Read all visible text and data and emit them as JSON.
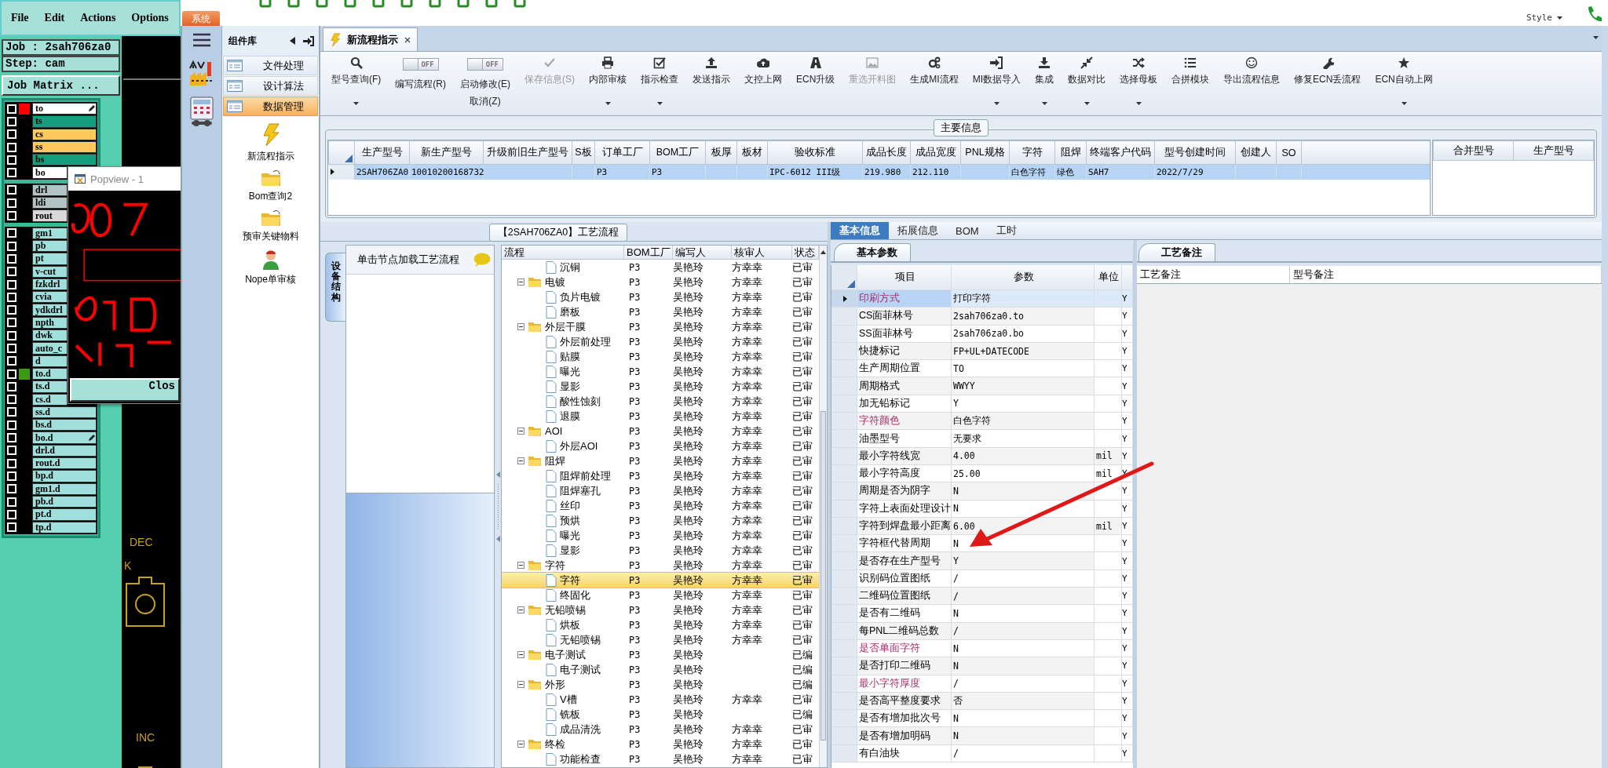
{
  "cam": {
    "menu": [
      "File",
      "Edit",
      "Actions",
      "Options"
    ],
    "job": "Job : 2sah706za0",
    "step": "Step: cam",
    "matrix_button": "Job Matrix ...",
    "layer_groups": [
      [
        {
          "name": "to",
          "kind": "legend",
          "color": "#ff0000",
          "checked": false,
          "flagged": true
        },
        {
          "name": "ts",
          "kind": "mask",
          "checked": false,
          "flagged": false
        },
        {
          "name": "cs",
          "kind": "copper",
          "checked": false,
          "flagged": false
        },
        {
          "name": "ss",
          "kind": "copper",
          "checked": false,
          "flagged": false
        },
        {
          "name": "bs",
          "kind": "mask",
          "checked": false,
          "flagged": false
        },
        {
          "name": "bo",
          "kind": "legend",
          "checked": false
        }
      ],
      [
        {
          "name": "drl",
          "kind": "drill",
          "checked": false
        },
        {
          "name": "ldi",
          "kind": "drill",
          "checked": false
        },
        {
          "name": "rout",
          "kind": "route",
          "checked": false
        }
      ],
      [
        {
          "name": "gm1",
          "kind": "misc",
          "checked": false
        },
        {
          "name": "pb",
          "kind": "misc",
          "checked": false
        },
        {
          "name": "pt",
          "kind": "misc",
          "checked": false
        },
        {
          "name": "v-cut",
          "kind": "misc",
          "checked": false
        },
        {
          "name": "fzkdrl",
          "kind": "misc",
          "checked": false
        },
        {
          "name": "cvia",
          "kind": "misc",
          "checked": false
        },
        {
          "name": "ydkdrl",
          "kind": "misc",
          "checked": false
        },
        {
          "name": "npth",
          "kind": "misc",
          "checked": false
        },
        {
          "name": "dwk",
          "kind": "misc",
          "checked": false
        },
        {
          "name": "auto_c",
          "kind": "misc",
          "checked": false
        },
        {
          "name": "d",
          "kind": "misc",
          "checked": false
        },
        {
          "name": "to.d",
          "kind": "misc",
          "color": "#3c9a10",
          "checked": false
        },
        {
          "name": "ts.d",
          "kind": "misc",
          "checked": false
        },
        {
          "name": "cs.d",
          "kind": "misc",
          "checked": false
        },
        {
          "name": "ss.d",
          "kind": "misc",
          "checked": false,
          "flagged": false
        },
        {
          "name": "bs.d",
          "kind": "misc",
          "checked": false,
          "flagged": false
        },
        {
          "name": "bo.d",
          "kind": "misc",
          "checked": false,
          "flagged": true
        },
        {
          "name": "drl.d",
          "kind": "misc",
          "checked": false,
          "flagged": false
        },
        {
          "name": "rout.d",
          "kind": "misc",
          "checked": false,
          "flagged": false
        },
        {
          "name": "bp.d",
          "kind": "misc",
          "checked": false,
          "flagged": false
        },
        {
          "name": "gm1.d",
          "kind": "misc",
          "checked": false,
          "flagged": false
        },
        {
          "name": "pb.d",
          "kind": "misc",
          "checked": false,
          "flagged": false
        },
        {
          "name": "pt.d",
          "kind": "misc",
          "checked": false,
          "flagged": false
        },
        {
          "name": "tp.d",
          "kind": "misc",
          "checked": false,
          "flagged": false
        }
      ]
    ],
    "popup": {
      "title": "Popview - 1",
      "button": "Clos"
    },
    "canvas_labels": [
      "DEC",
      "K",
      "INC"
    ]
  },
  "system_tab": "系统",
  "style_menu": "Style",
  "component_panel": {
    "title": "组件库",
    "categories": [
      {
        "label": "文件处理",
        "selected": false
      },
      {
        "label": "设计算法",
        "selected": false
      },
      {
        "label": "数据管理",
        "selected": true
      }
    ],
    "tools": [
      {
        "label": "新流程指示",
        "kind": "lightning"
      },
      {
        "label": "Bom查询2",
        "kind": "folder"
      },
      {
        "label": "预审关键物料",
        "kind": "folder"
      },
      {
        "label": "Nope单审核",
        "kind": "person"
      }
    ]
  },
  "document_tab": "新流程指示",
  "ribbon": [
    {
      "kind": "button",
      "label": "型号查询(F)",
      "dropdown": true,
      "disabled": false
    },
    {
      "kind": "toggle",
      "label": "编写流程(R)",
      "switch_text": "OFF",
      "on": false
    },
    {
      "kind": "toggle",
      "label": "启动修改(E)",
      "sublabel": "取消(Z)",
      "switch_text": "OFF",
      "on": false
    },
    {
      "kind": "button",
      "label": "保存信息(S)",
      "dropdown": false,
      "disabled": true
    },
    {
      "kind": "button",
      "label": "内部审核",
      "dropdown": true,
      "disabled": false
    },
    {
      "kind": "button",
      "label": "指示检查",
      "dropdown": true,
      "disabled": false
    },
    {
      "kind": "button",
      "label": "发送指示",
      "dropdown": false,
      "disabled": false
    },
    {
      "kind": "button",
      "label": "文控上网",
      "dropdown": false,
      "disabled": false
    },
    {
      "kind": "button",
      "label": "ECN升级",
      "dropdown": false,
      "disabled": false
    },
    {
      "kind": "button",
      "label": "重选开料图",
      "dropdown": false,
      "disabled": true
    },
    {
      "kind": "button",
      "label": "生成MI流程",
      "dropdown": false,
      "disabled": false
    },
    {
      "kind": "button",
      "label": "MI数据导入",
      "dropdown": true,
      "disabled": false
    },
    {
      "kind": "button",
      "label": "集成",
      "dropdown": true,
      "disabled": false
    },
    {
      "kind": "button",
      "label": "数据对比",
      "dropdown": true,
      "disabled": false
    },
    {
      "kind": "button",
      "label": "选择母板",
      "dropdown": true,
      "disabled": false
    },
    {
      "kind": "button",
      "label": "合拼模块",
      "dropdown": false,
      "disabled": false
    },
    {
      "kind": "button",
      "label": "导出流程信息",
      "dropdown": false,
      "disabled": false
    },
    {
      "kind": "button",
      "label": "修复ECN丢流程",
      "dropdown": false,
      "disabled": false
    },
    {
      "kind": "button",
      "label": "ECN自动上网",
      "dropdown": true,
      "disabled": false
    }
  ],
  "main_info": {
    "title": "主要信息",
    "columns": [
      "生产型号",
      "新生产型号",
      "升级前旧生产型号",
      "S板",
      "订单工厂",
      "BOM工厂",
      "板厚",
      "板材",
      "验收标准",
      "成品长度",
      "成品宽度",
      "PNL规格",
      "字符",
      "阻焊",
      "终端客户代码",
      "型号创建时间",
      "创建人",
      "SO"
    ],
    "rows": [
      {
        "selected": true,
        "cells": [
          "2SAH706ZA0",
          "10010200168732",
          null,
          null,
          "P3",
          "P3",
          null,
          null,
          "IPC-6012 III级",
          "219.980",
          "212.110",
          null,
          "白色字符",
          "绿色",
          "SAH7",
          "2022/7/29",
          null,
          null
        ]
      }
    ],
    "merge_columns": [
      "合并型号",
      "生产型号"
    ]
  },
  "flow_panel": {
    "title": "【2SAH706ZA0】工艺流程",
    "side_tab": "设备结构",
    "hint": "单击节点加载工艺流程",
    "columns": [
      "流程",
      "BOM工厂",
      "编写人",
      "核审人",
      "状态"
    ],
    "tree": [
      {
        "kind": "step",
        "label": "沉铜",
        "bom": "P3",
        "writer": "吴艳玲",
        "reviewer": "方幸幸",
        "status": "已审",
        "selected": false
      },
      {
        "kind": "folder",
        "label": "电镀",
        "bom": "P3",
        "writer": "吴艳玲",
        "reviewer": "方幸幸",
        "status": "已审",
        "selected": false,
        "expanded": true,
        "children": [
          {
            "kind": "step",
            "label": "负片电镀",
            "bom": "P3",
            "writer": "吴艳玲",
            "reviewer": "方幸幸",
            "status": "已审",
            "selected": false
          },
          {
            "kind": "step",
            "label": "磨板",
            "bom": "P3",
            "writer": "吴艳玲",
            "reviewer": "方幸幸",
            "status": "已审",
            "selected": false
          }
        ]
      },
      {
        "kind": "folder",
        "label": "外层干膜",
        "bom": "P3",
        "writer": "吴艳玲",
        "reviewer": "方幸幸",
        "status": "已审",
        "selected": false,
        "expanded": true,
        "children": [
          {
            "kind": "step",
            "label": "外层前处理",
            "bom": "P3",
            "writer": "吴艳玲",
            "reviewer": "方幸幸",
            "status": "已审",
            "selected": false
          },
          {
            "kind": "step",
            "label": "贴膜",
            "bom": "P3",
            "writer": "吴艳玲",
            "reviewer": "方幸幸",
            "status": "已审",
            "selected": false
          },
          {
            "kind": "step",
            "label": "曝光",
            "bom": "P3",
            "writer": "吴艳玲",
            "reviewer": "方幸幸",
            "status": "已审",
            "selected": false
          },
          {
            "kind": "step",
            "label": "显影",
            "bom": "P3",
            "writer": "吴艳玲",
            "reviewer": "方幸幸",
            "status": "已审",
            "selected": false
          },
          {
            "kind": "step",
            "label": "酸性蚀刻",
            "bom": "P3",
            "writer": "吴艳玲",
            "reviewer": "方幸幸",
            "status": "已审",
            "selected": false
          },
          {
            "kind": "step",
            "label": "退膜",
            "bom": "P3",
            "writer": "吴艳玲",
            "reviewer": "方幸幸",
            "status": "已审",
            "selected": false
          }
        ]
      },
      {
        "kind": "folder",
        "label": "AOI",
        "bom": "P3",
        "writer": "吴艳玲",
        "reviewer": "方幸幸",
        "status": "已审",
        "selected": false,
        "expanded": true,
        "children": [
          {
            "kind": "step",
            "label": "外层AOI",
            "bom": "P3",
            "writer": "吴艳玲",
            "reviewer": "方幸幸",
            "status": "已审",
            "selected": false
          }
        ]
      },
      {
        "kind": "folder",
        "label": "阻焊",
        "bom": "P3",
        "writer": "吴艳玲",
        "reviewer": "方幸幸",
        "status": "已审",
        "selected": false,
        "expanded": true,
        "children": [
          {
            "kind": "step",
            "label": "阻焊前处理",
            "bom": "P3",
            "writer": "吴艳玲",
            "reviewer": "方幸幸",
            "status": "已审",
            "selected": false
          },
          {
            "kind": "step",
            "label": "阻焊塞孔",
            "bom": "P3",
            "writer": "吴艳玲",
            "reviewer": "方幸幸",
            "status": "已审",
            "selected": false
          },
          {
            "kind": "step",
            "label": "丝印",
            "bom": "P3",
            "writer": "吴艳玲",
            "reviewer": "方幸幸",
            "status": "已审",
            "selected": false
          },
          {
            "kind": "step",
            "label": "预烘",
            "bom": "P3",
            "writer": "吴艳玲",
            "reviewer": "方幸幸",
            "status": "已审",
            "selected": false
          },
          {
            "kind": "step",
            "label": "曝光",
            "bom": "P3",
            "writer": "吴艳玲",
            "reviewer": "方幸幸",
            "status": "已审",
            "selected": false
          },
          {
            "kind": "step",
            "label": "显影",
            "bom": "P3",
            "writer": "吴艳玲",
            "reviewer": "方幸幸",
            "status": "已审",
            "selected": false
          }
        ]
      },
      {
        "kind": "folder",
        "label": "字符",
        "bom": "P3",
        "writer": "吴艳玲",
        "reviewer": "方幸幸",
        "status": "已审",
        "selected": false,
        "expanded": true,
        "children": [
          {
            "kind": "step",
            "label": "字符",
            "bom": "P3",
            "writer": "吴艳玲",
            "reviewer": "方幸幸",
            "status": "已审",
            "selected": true
          },
          {
            "kind": "step",
            "label": "终固化",
            "bom": "P3",
            "writer": "吴艳玲",
            "reviewer": "方幸幸",
            "status": "已审",
            "selected": false
          }
        ]
      },
      {
        "kind": "folder",
        "label": "无铅喷锡",
        "bom": "P3",
        "writer": "吴艳玲",
        "reviewer": "方幸幸",
        "status": "已审",
        "selected": false,
        "expanded": true,
        "children": [
          {
            "kind": "step",
            "label": "烘板",
            "bom": "P3",
            "writer": "吴艳玲",
            "reviewer": "方幸幸",
            "status": "已审",
            "selected": false
          },
          {
            "kind": "step",
            "label": "无铅喷锡",
            "bom": "P3",
            "writer": "吴艳玲",
            "reviewer": "方幸幸",
            "status": "已审",
            "selected": false
          }
        ]
      },
      {
        "kind": "folder",
        "label": "电子测试",
        "bom": "P3",
        "writer": "吴艳玲",
        "status": "已编",
        "selected": false,
        "expanded": true,
        "children": [
          {
            "kind": "step",
            "label": "电子测试",
            "bom": "P3",
            "writer": "吴艳玲",
            "status": "已编",
            "selected": false
          }
        ]
      },
      {
        "kind": "folder",
        "label": "外形",
        "bom": "P3",
        "writer": "吴艳玲",
        "status": "已编",
        "selected": false,
        "expanded": true,
        "children": [
          {
            "kind": "step",
            "label": "V槽",
            "bom": "P3",
            "writer": "吴艳玲",
            "reviewer": "方幸幸",
            "status": "已审",
            "selected": false
          },
          {
            "kind": "step",
            "label": "铣板",
            "bom": "P3",
            "writer": "吴艳玲",
            "status": "已编",
            "selected": false
          },
          {
            "kind": "step",
            "label": "成品清洗",
            "bom": "P3",
            "writer": "吴艳玲",
            "reviewer": "方幸幸",
            "status": "已审",
            "selected": false
          }
        ]
      },
      {
        "kind": "folder",
        "label": "终检",
        "bom": "P3",
        "writer": "吴艳玲",
        "reviewer": "方幸幸",
        "status": "已审",
        "selected": false,
        "expanded": true,
        "children": [
          {
            "kind": "step",
            "label": "功能检查",
            "bom": "P3",
            "writer": "吴艳玲",
            "reviewer": "方幸幸",
            "status": "已审",
            "selected": false
          }
        ]
      }
    ]
  },
  "detail_panel": {
    "tabs": [
      {
        "label": "基本信息",
        "selected": true
      },
      {
        "label": "拓展信息",
        "selected": false
      },
      {
        "label": "BOM",
        "selected": false
      },
      {
        "label": "工时",
        "selected": false
      }
    ],
    "subtab": "基本参数",
    "columns": [
      "项目",
      "参数",
      "单位"
    ],
    "rows": [
      {
        "item": "印刷方式",
        "value": "打印字符",
        "flag": "Y",
        "highlighted": true,
        "selected": true
      },
      {
        "item": "CS面菲林号",
        "value": "2sah706za0.to",
        "flag": "Y",
        "highlighted": false,
        "selected": false
      },
      {
        "item": "SS面菲林号",
        "value": "2sah706za0.bo",
        "flag": "Y",
        "highlighted": false,
        "selected": false
      },
      {
        "item": "快捷标记",
        "value": "FP+UL+DATECODE",
        "flag": "Y",
        "highlighted": false,
        "selected": false
      },
      {
        "item": "生产周期位置",
        "value": "TO",
        "flag": "Y",
        "highlighted": false,
        "selected": false
      },
      {
        "item": "周期格式",
        "value": "WWYY",
        "flag": "Y",
        "highlighted": false,
        "selected": false
      },
      {
        "item": "加无铅标记",
        "value": "Y",
        "flag": "Y",
        "highlighted": false,
        "selected": false
      },
      {
        "item": "字符颜色",
        "value": "白色字符",
        "flag": "Y",
        "highlighted": true,
        "selected": false
      },
      {
        "item": "油墨型号",
        "value": "无要求",
        "flag": "Y",
        "highlighted": false,
        "selected": false
      },
      {
        "item": "最小字符线宽",
        "value": "4.00",
        "unit": "mil",
        "flag": "Y",
        "highlighted": false,
        "selected": false
      },
      {
        "item": "最小字符高度",
        "value": "25.00",
        "unit": "mil",
        "flag": "Y",
        "highlighted": false,
        "selected": false
      },
      {
        "item": "周期是否为阴字",
        "value": "N",
        "flag": "Y",
        "highlighted": false,
        "selected": false
      },
      {
        "item": "字符上表面处理设计",
        "value": "N",
        "flag": "Y",
        "highlighted": false,
        "selected": false
      },
      {
        "item": "字符到焊盘最小距离",
        "value": "6.00",
        "unit": "mil",
        "flag": "Y",
        "highlighted": false,
        "selected": false
      },
      {
        "item": "字符框代替周期",
        "value": "N",
        "flag": "Y",
        "highlighted": false,
        "selected": false
      },
      {
        "item": "是否存在生产型号",
        "value": "Y",
        "flag": "Y",
        "highlighted": false,
        "selected": false
      },
      {
        "item": "识别码位置图纸",
        "value": "/",
        "flag": "Y",
        "highlighted": false,
        "selected": false
      },
      {
        "item": "二维码位置图纸",
        "value": "/",
        "flag": "Y",
        "highlighted": false,
        "selected": false
      },
      {
        "item": "是否有二维码",
        "value": "N",
        "flag": "Y",
        "highlighted": false,
        "selected": false
      },
      {
        "item": "每PNL二维码总数",
        "value": "/",
        "flag": "Y",
        "highlighted": false,
        "selected": false
      },
      {
        "item": "是否单面字符",
        "value": "N",
        "flag": "Y",
        "highlighted": true,
        "selected": false
      },
      {
        "item": "是否打印二维码",
        "value": "N",
        "flag": "Y",
        "highlighted": false,
        "selected": false
      },
      {
        "item": "最小字符厚度",
        "value": "/",
        "flag": "Y",
        "highlighted": true,
        "selected": false
      },
      {
        "item": "是否高平整度要求",
        "value": "否",
        "flag": "Y",
        "highlighted": false,
        "selected": false
      },
      {
        "item": "是否有增加批次号",
        "value": "N",
        "flag": "Y",
        "highlighted": false,
        "selected": false
      },
      {
        "item": "是否有增加明码",
        "value": "N",
        "flag": "Y",
        "highlighted": false,
        "selected": false
      },
      {
        "item": "有白油块",
        "value": "/",
        "flag": "Y",
        "highlighted": false,
        "selected": false
      }
    ],
    "notes_tab": "工艺备注",
    "notes_columns": [
      "工艺备注",
      "型号备注"
    ]
  }
}
